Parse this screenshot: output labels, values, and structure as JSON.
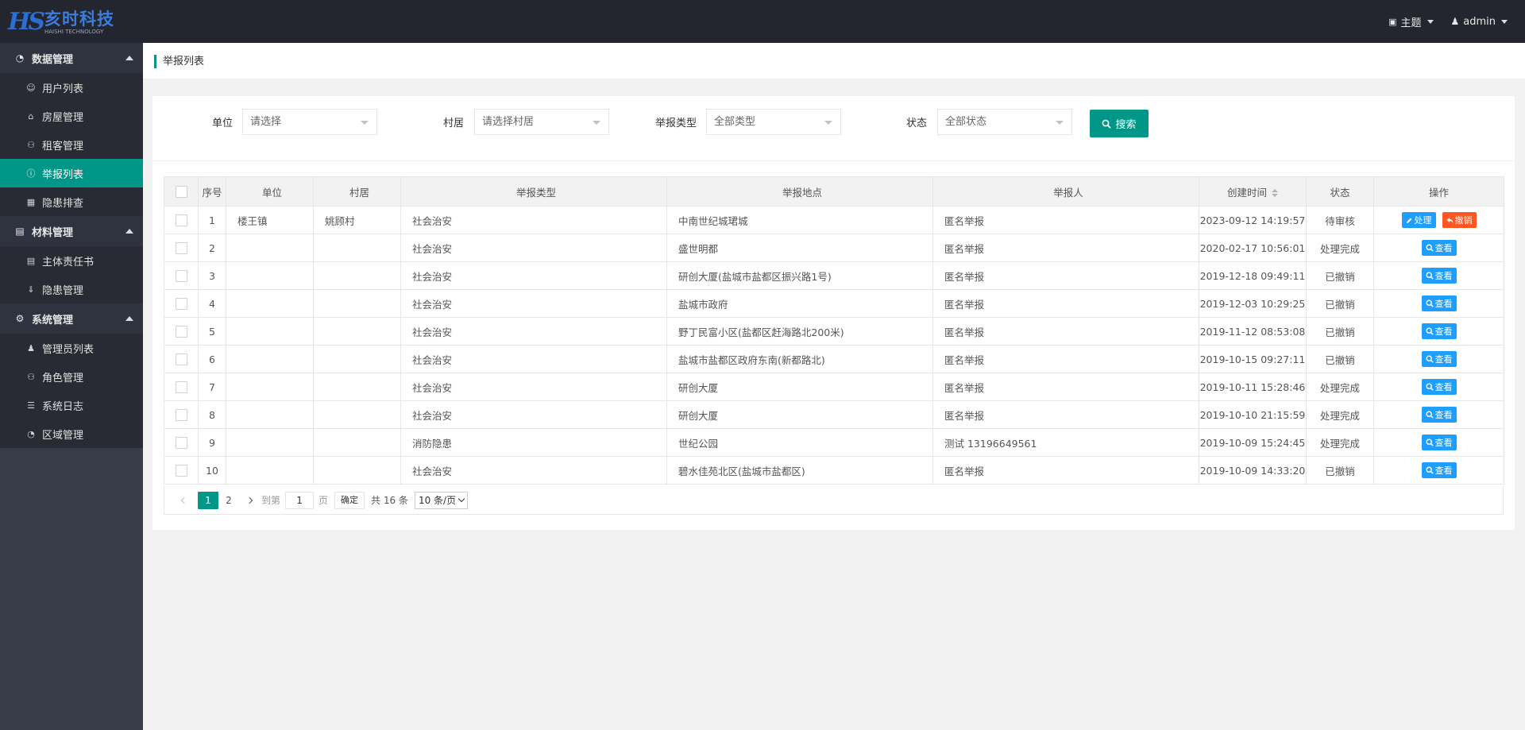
{
  "header": {
    "logo_cn": "亥时科技",
    "logo_en": "HAISHI TECHNOLOGY",
    "logo_mark": "HS",
    "theme_label": "主题",
    "user_label": "admin"
  },
  "sidebar": {
    "groups": [
      {
        "label": "数据管理",
        "icon": "chart-icon",
        "items": [
          {
            "label": "用户列表",
            "icon": "user-icon",
            "active": false
          },
          {
            "label": "房屋管理",
            "icon": "home-icon",
            "active": false
          },
          {
            "label": "租客管理",
            "icon": "users-icon",
            "active": false
          },
          {
            "label": "举报列表",
            "icon": "alert-icon",
            "active": true
          },
          {
            "label": "隐患排查",
            "icon": "building-icon",
            "active": false
          }
        ]
      },
      {
        "label": "材料管理",
        "icon": "doc-icon",
        "items": [
          {
            "label": "主体责任书",
            "icon": "file-icon",
            "active": false
          },
          {
            "label": "隐患管理",
            "icon": "download-icon",
            "active": false
          }
        ]
      },
      {
        "label": "系统管理",
        "icon": "gear-icon",
        "items": [
          {
            "label": "管理员列表",
            "icon": "person-icon",
            "active": false
          },
          {
            "label": "角色管理",
            "icon": "role-icon",
            "active": false
          },
          {
            "label": "系统日志",
            "icon": "log-icon",
            "active": false
          },
          {
            "label": "区域管理",
            "icon": "region-icon",
            "active": false
          }
        ]
      }
    ]
  },
  "tab": {
    "title": "举报列表"
  },
  "filters": {
    "unit_label": "单位",
    "unit_value": "请选择",
    "village_label": "村居",
    "village_value": "请选择村居",
    "type_label": "举报类型",
    "type_value": "全部类型",
    "status_label": "状态",
    "status_value": "全部状态",
    "search_label": "搜索"
  },
  "table": {
    "headers": [
      "序号",
      "单位",
      "村居",
      "举报类型",
      "举报地点",
      "举报人",
      "创建时间",
      "状态",
      "操作"
    ],
    "rows": [
      {
        "no": "1",
        "unit": "楼王镇",
        "village": "姚顾村",
        "type": "社会治安",
        "place": "中南世纪城珺城",
        "reporter": "匿名举报",
        "time": "2023-09-12 14:19:57",
        "status": "待审核",
        "actions": [
          "处理",
          "撤销"
        ]
      },
      {
        "no": "2",
        "unit": "",
        "village": "",
        "type": "社会治安",
        "place": "盛世明都",
        "reporter": "匿名举报",
        "time": "2020-02-17 10:56:01",
        "status": "处理完成",
        "actions": [
          "查看"
        ]
      },
      {
        "no": "3",
        "unit": "",
        "village": "",
        "type": "社会治安",
        "place": "研创大厦(盐城市盐都区振兴路1号)",
        "reporter": "匿名举报",
        "time": "2019-12-18 09:49:11",
        "status": "已撤销",
        "actions": [
          "查看"
        ]
      },
      {
        "no": "4",
        "unit": "",
        "village": "",
        "type": "社会治安",
        "place": "盐城市政府",
        "reporter": "匿名举报",
        "time": "2019-12-03 10:29:25",
        "status": "已撤销",
        "actions": [
          "查看"
        ]
      },
      {
        "no": "5",
        "unit": "",
        "village": "",
        "type": "社会治安",
        "place": "野丁民富小区(盐都区赶海路北200米)",
        "reporter": "匿名举报",
        "time": "2019-11-12 08:53:08",
        "status": "已撤销",
        "actions": [
          "查看"
        ]
      },
      {
        "no": "6",
        "unit": "",
        "village": "",
        "type": "社会治安",
        "place": "盐城市盐都区政府东南(新都路北)",
        "reporter": "匿名举报",
        "time": "2019-10-15 09:27:11",
        "status": "已撤销",
        "actions": [
          "查看"
        ]
      },
      {
        "no": "7",
        "unit": "",
        "village": "",
        "type": "社会治安",
        "place": "研创大厦",
        "reporter": "匿名举报",
        "time": "2019-10-11 15:28:46",
        "status": "处理完成",
        "actions": [
          "查看"
        ]
      },
      {
        "no": "8",
        "unit": "",
        "village": "",
        "type": "社会治安",
        "place": "研创大厦",
        "reporter": "匿名举报",
        "time": "2019-10-10 21:15:59",
        "status": "处理完成",
        "actions": [
          "查看"
        ]
      },
      {
        "no": "9",
        "unit": "",
        "village": "",
        "type": "消防隐患",
        "place": "世纪公园",
        "reporter": "测试 13196649561",
        "time": "2019-10-09 15:24:45",
        "status": "处理完成",
        "actions": [
          "查看"
        ]
      },
      {
        "no": "10",
        "unit": "",
        "village": "",
        "type": "社会治安",
        "place": "碧水佳苑北区(盐城市盐都区)",
        "reporter": "匿名举报",
        "time": "2019-10-09 14:33:20",
        "status": "已撤销",
        "actions": [
          "查看"
        ]
      }
    ]
  },
  "pager": {
    "pages": [
      "1",
      "2"
    ],
    "current": "1",
    "goto_label": "到第",
    "goto_value": "1",
    "page_unit": "页",
    "confirm_label": "确定",
    "total_label": "共 16 条",
    "size_label": "10 条/页"
  },
  "colors": {
    "accent": "#009688",
    "blue": "#1e9fff",
    "orange": "#ff5722",
    "header_bg": "#23262e",
    "sidebar_bg": "#393d49"
  }
}
